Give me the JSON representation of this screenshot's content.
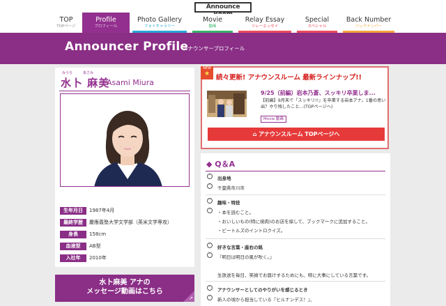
{
  "logo": {
    "text": "Announce Room"
  },
  "nav": [
    {
      "en": "TOP",
      "ja": "TOPページ",
      "color": "#ffffff"
    },
    {
      "en": "Profile",
      "ja": "プロフィール",
      "color": "#93308f"
    },
    {
      "en": "Photo Gallery",
      "ja": "フォトギャラリー",
      "color": "#2aa7d6"
    },
    {
      "en": "Movie",
      "ja": "動画",
      "color": "#38b36a"
    },
    {
      "en": "Relay Essay",
      "ja": "リレーエッセイ",
      "color": "#e94b5c"
    },
    {
      "en": "Special",
      "ja": "スペシャル",
      "color": "#e94b5c"
    },
    {
      "en": "Back Number",
      "ja": "バックナンバー",
      "color": "#f3a43b"
    }
  ],
  "banner": {
    "title": "Announcer Profile",
    "subtitle": "アナウンサープロフィール"
  },
  "profile": {
    "ruby_family": "みうら",
    "ruby_given": "あさみ",
    "name_ja": "水卜 麻美",
    "name_en": "Asami Miura",
    "rows": [
      {
        "label": "生年月日",
        "value": "1987年4月"
      },
      {
        "label": "最終学歴",
        "value": "慶應義塾大学文学部（英米文学専攻）"
      },
      {
        "label": "身長",
        "value": "158cm"
      },
      {
        "label": "血液型",
        "value": "AB型"
      },
      {
        "label": "入社年",
        "value": "2010年"
      }
    ]
  },
  "message_button": {
    "line1": "水卜麻美 アナの",
    "line2": "メッセージ動画はこちら"
  },
  "news": {
    "badge": "NEW",
    "headline": "続々更新! アナウンスルーム 最新ラインナップ!!",
    "title": "9/25（前編）岩本乃蒼、スッキリ卒業しま...",
    "desc": "【前編】9月末で「スッキリ!!」を卒業する岩本アナ。1番の思い出？やり残したこと...(TOPページへ)",
    "tag": "Movie 動画",
    "top_button": "アナウンスルーム TOPページへ"
  },
  "qa": {
    "heading": "Q＆A",
    "items": [
      {
        "q": "出身地",
        "a": [
          "千葉県市川市"
        ]
      },
      {
        "q": "趣味・特技",
        "a": [
          "・本を読むこと。",
          "・おいしいもの(特に焼肉)のお店を探して、ブックマークに追加すること。",
          "・ビートルズのイントロクイズ。"
        ]
      },
      {
        "q": "好きな言葉・座右の銘",
        "a": [
          "『明日は明日の風が吹く。』",
          "",
          "生放送を毎日、笑顔でお届けするためにも、特に大事にしている言葉です。"
        ]
      },
      {
        "q": "アナウンサーとしてのやりがいを感じるとき",
        "a": [
          "新人の頃から担当している『ヒルナンデス！』、"
        ]
      }
    ]
  }
}
